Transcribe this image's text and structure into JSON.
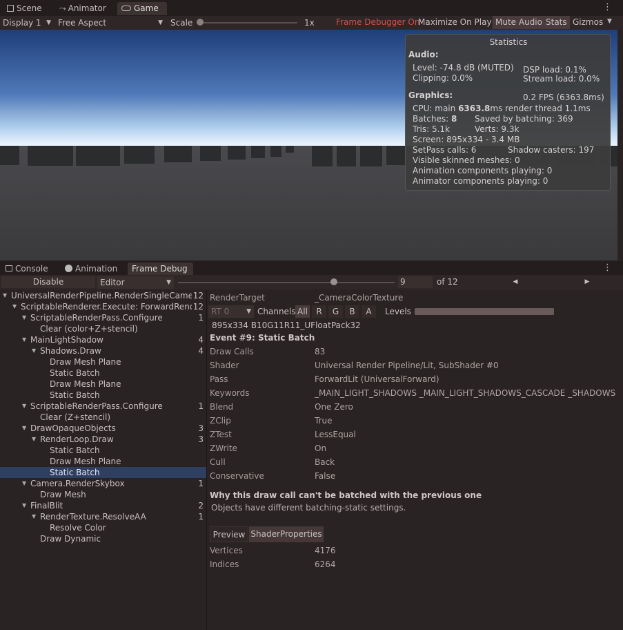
{
  "top_tabs": [
    {
      "label": "Scene",
      "icon": "scene-grid-icon"
    },
    {
      "label": "Animator",
      "icon": "animator-icon"
    },
    {
      "label": "Game",
      "icon": "gamepad-icon"
    }
  ],
  "game_toolbar": {
    "display": "Display 1",
    "aspect": "Free Aspect",
    "scale_label": "Scale",
    "scale_value": "1x",
    "scale_fraction": 0.0,
    "frame_debugger": "Frame Debugger On",
    "maximize": "Maximize On Play",
    "mute": "Mute Audio",
    "stats": "Stats",
    "gizmos": "Gizmos"
  },
  "statistics": {
    "title": "Statistics",
    "audio_header": "Audio:",
    "level": "Level: -74.8 dB (MUTED)",
    "clipping": "Clipping: 0.0%",
    "dsp": "DSP load: 0.1%",
    "stream": "Stream load: 0.0%",
    "graphics_header": "Graphics:",
    "fps": "0.2 FPS (6363.8ms)",
    "cpu_prefix": "CPU: main ",
    "cpu_main": "6363.8",
    "cpu_suffix": "ms  render thread 1.1ms",
    "batches_prefix": "Batches: ",
    "batches": "8",
    "saved": "Saved by batching: 369",
    "tris": "Tris: 5.1k",
    "verts": "Verts: 9.3k",
    "screen": "Screen: 895x334 - 3.4 MB",
    "setpass": "SetPass calls: 6",
    "shadow": "Shadow casters: 197",
    "skinned": "Visible skinned meshes: 0",
    "anim_components": "Animation components playing: 0",
    "animator_components": "Animator components playing: 0"
  },
  "bottom_tabs": [
    {
      "label": "Console",
      "icon": "console-icon"
    },
    {
      "label": "Animation",
      "icon": "animation-clock-icon"
    },
    {
      "label": "Frame Debug",
      "icon": ""
    }
  ],
  "fd_toolbar": {
    "disable": "Disable",
    "target": "Editor",
    "event_index": "9",
    "of_label": "of 12",
    "slider_fraction": 0.73,
    "prev": "◀",
    "next": "▶"
  },
  "tree": [
    {
      "label": "UniversalRenderPipeline.RenderSingleCamera:",
      "count": "12",
      "indent": 0,
      "expanded": true
    },
    {
      "label": "ScriptableRenderer.Execute: ForwardRender",
      "count": "12",
      "indent": 1,
      "expanded": true
    },
    {
      "label": "ScriptableRenderPass.Configure",
      "count": "1",
      "indent": 2,
      "expanded": true
    },
    {
      "label": "Clear (color+Z+stencil)",
      "count": "",
      "indent": 3,
      "expanded": null
    },
    {
      "label": "MainLightShadow",
      "count": "4",
      "indent": 2,
      "expanded": true
    },
    {
      "label": "Shadows.Draw",
      "count": "4",
      "indent": 3,
      "expanded": true
    },
    {
      "label": "Draw Mesh Plane",
      "count": "",
      "indent": 4,
      "expanded": null
    },
    {
      "label": "Static Batch",
      "count": "",
      "indent": 4,
      "expanded": null
    },
    {
      "label": "Draw Mesh Plane",
      "count": "",
      "indent": 4,
      "expanded": null
    },
    {
      "label": "Static Batch",
      "count": "",
      "indent": 4,
      "expanded": null
    },
    {
      "label": "ScriptableRenderPass.Configure",
      "count": "1",
      "indent": 2,
      "expanded": true
    },
    {
      "label": "Clear (Z+stencil)",
      "count": "",
      "indent": 3,
      "expanded": null
    },
    {
      "label": "DrawOpaqueObjects",
      "count": "3",
      "indent": 2,
      "expanded": true
    },
    {
      "label": "RenderLoop.Draw",
      "count": "3",
      "indent": 3,
      "expanded": true
    },
    {
      "label": "Static Batch",
      "count": "",
      "indent": 4,
      "expanded": null
    },
    {
      "label": "Draw Mesh Plane",
      "count": "",
      "indent": 4,
      "expanded": null
    },
    {
      "label": "Static Batch",
      "count": "",
      "indent": 4,
      "expanded": null,
      "selected": true
    },
    {
      "label": "Camera.RenderSkybox",
      "count": "1",
      "indent": 2,
      "expanded": true
    },
    {
      "label": "Draw Mesh",
      "count": "",
      "indent": 3,
      "expanded": null
    },
    {
      "label": "FinalBlit",
      "count": "2",
      "indent": 2,
      "expanded": true
    },
    {
      "label": "RenderTexture.ResolveAA",
      "count": "1",
      "indent": 3,
      "expanded": true
    },
    {
      "label": "Resolve Color",
      "count": "",
      "indent": 4,
      "expanded": null
    },
    {
      "label": "Draw Dynamic",
      "count": "",
      "indent": 3,
      "expanded": null
    }
  ],
  "detail": {
    "render_target_label": "RenderTarget",
    "render_target_value": "_CameraColorTexture",
    "rt_select": "RT 0",
    "channels_label": "Channels",
    "channels": [
      "All",
      "R",
      "G",
      "B",
      "A"
    ],
    "levels_label": "Levels",
    "format": "895x334 B10G11R11_UFloatPack32",
    "event_title": "Event #9: Static Batch",
    "props": [
      {
        "k": "Draw Calls",
        "v": "83"
      },
      {
        "k": "Shader",
        "v": "Universal Render Pipeline/Lit, SubShader #0"
      },
      {
        "k": "Pass",
        "v": "ForwardLit (UniversalForward)"
      },
      {
        "k": "Keywords",
        "v": "_MAIN_LIGHT_SHADOWS _MAIN_LIGHT_SHADOWS_CASCADE _SHADOWS_S"
      },
      {
        "k": "Blend",
        "v": "One Zero"
      },
      {
        "k": "ZClip",
        "v": "True"
      },
      {
        "k": "ZTest",
        "v": "LessEqual"
      },
      {
        "k": "ZWrite",
        "v": "On"
      },
      {
        "k": "Cull",
        "v": "Back"
      },
      {
        "k": "Conservative",
        "v": "False"
      }
    ],
    "batch_reason_title": "Why this draw call can't be batched with the previous one",
    "batch_reason": "Objects have different batching-static settings.",
    "sub_tabs": [
      "Preview",
      "ShaderProperties"
    ],
    "mesh_props": [
      {
        "k": "Vertices",
        "v": "4176"
      },
      {
        "k": "Indices",
        "v": "6264"
      }
    ]
  },
  "colors": {
    "frame_debugger_text": "#d05050",
    "selection": "#2f3f5f",
    "panel_bg": "#2a2323",
    "toolbar_bg": "#2f2727"
  }
}
